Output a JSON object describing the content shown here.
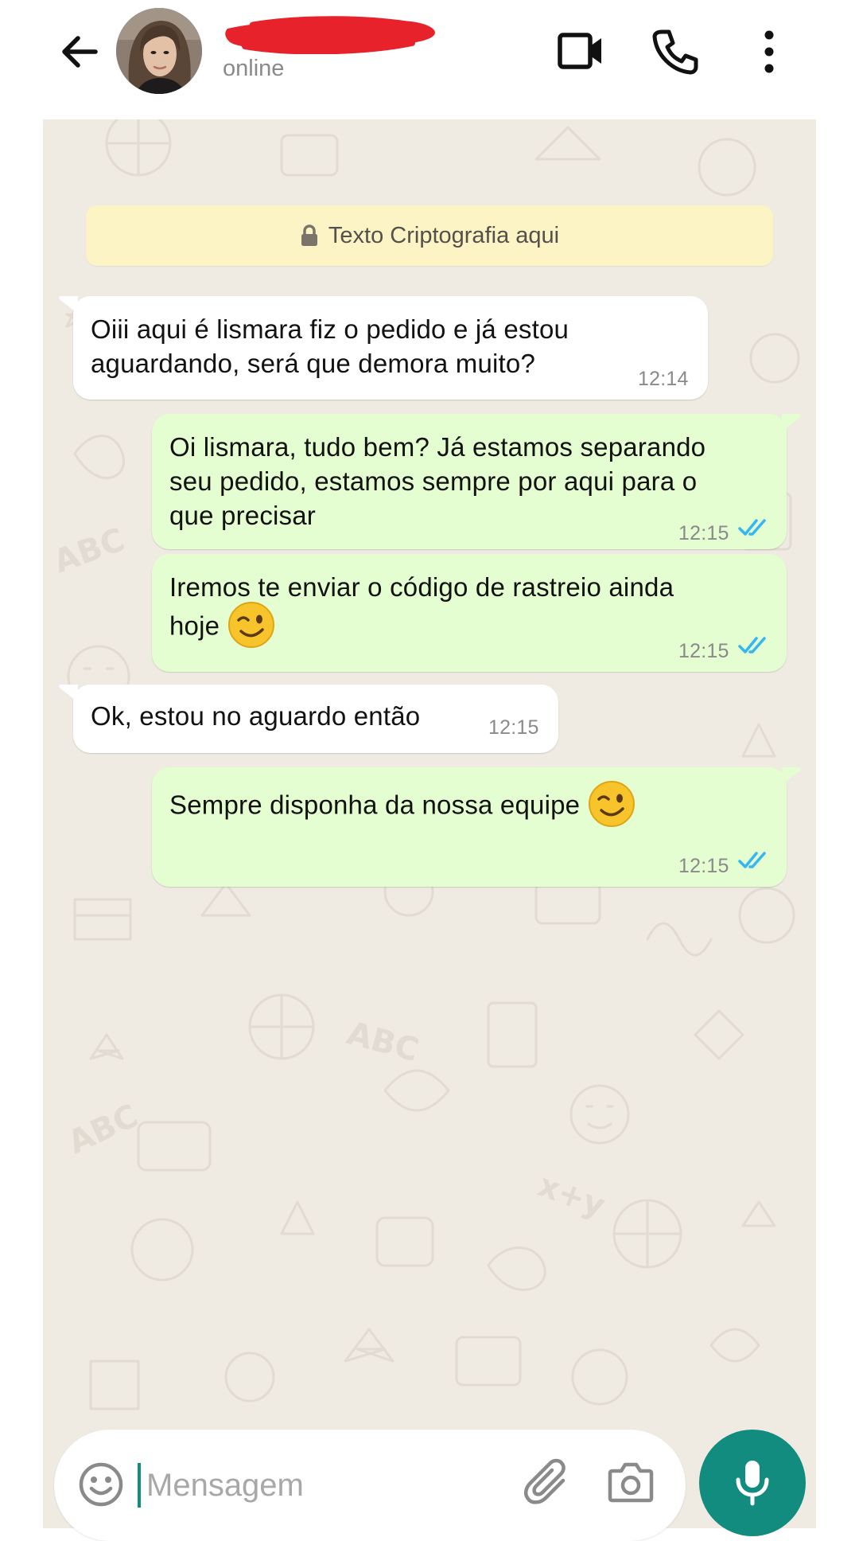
{
  "header": {
    "status": "online",
    "icons": {
      "back": "arrow-left-icon",
      "video": "video-camera-icon",
      "call": "phone-icon",
      "menu": "more-vertical-icon"
    }
  },
  "system_note": {
    "text": "Texto Criptografia aqui",
    "icon": "lock-icon"
  },
  "messages": [
    {
      "direction": "incoming",
      "lines": [
        "Oiii aqui é lismara fiz o pedido e já estou",
        "aguardando, será que demora muito?"
      ],
      "time": "12:14"
    },
    {
      "direction": "outgoing",
      "lines": [
        "Oi lismara, tudo bem? Já estamos separando",
        "seu pedido, estamos sempre por aqui para o",
        "que precisar"
      ],
      "time": "12:15",
      "read": true
    },
    {
      "direction": "outgoing",
      "lines": [
        "Iremos te enviar o código de rastreio ainda",
        "hoje"
      ],
      "emoji": "winking-face",
      "time": "12:15",
      "read": true
    },
    {
      "direction": "incoming",
      "lines": [
        "Ok, estou no aguardo então"
      ],
      "time": "12:15"
    },
    {
      "direction": "outgoing",
      "lines": [
        "Sempre disponha da nossa equipe"
      ],
      "emoji": "winking-face",
      "time": "12:15",
      "read": true
    }
  ],
  "input": {
    "placeholder": "Mensagem",
    "value": ""
  },
  "colors": {
    "chat_background": "#efeae2",
    "incoming_bubble": "#ffffff",
    "outgoing_bubble": "#e4fdd1",
    "system_note": "#fdf4c5",
    "accent": "#128c7e",
    "read_ticks": "#34b7f1",
    "redaction": "#e8222a"
  }
}
